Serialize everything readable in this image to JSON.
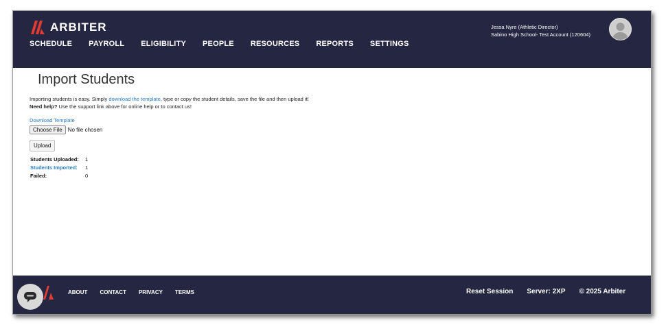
{
  "header": {
    "brand": "ARBITER",
    "nav": [
      "SCHEDULE",
      "PAYROLL",
      "ELIGIBILITY",
      "PEOPLE",
      "RESOURCES",
      "REPORTS",
      "SETTINGS"
    ],
    "user_name": "Jessa Nyre (Athletic Director)",
    "account": "Sabino High School- Test Account (120604)",
    "avatar_icon": "user-avatar-icon"
  },
  "main": {
    "title": "Import Students",
    "intro_prefix": "Importing students is easy. Simply ",
    "intro_link": "download the template",
    "intro_suffix": ", type or copy the student details, save the file and then upload it!",
    "help_label": "Need help?",
    "help_text": " Use the support link above for online help or to contact us!",
    "download_link": "Download Template",
    "choose_file": "Choose File",
    "no_file": "No file chosen",
    "upload": "Upload",
    "stats": [
      {
        "label": "Students Uploaded:",
        "value": "1"
      },
      {
        "label": "Students Imported:",
        "value": "1"
      },
      {
        "label": "Failed:",
        "value": "0"
      }
    ]
  },
  "footer": {
    "links": [
      "ABOUT",
      "CONTACT",
      "PRIVACY",
      "TERMS"
    ],
    "reset_session": "Reset Session",
    "server": "Server: 2XP",
    "copyright": "© 2025 Arbiter",
    "chat_icon": "chat-bubble-icon"
  },
  "colors": {
    "header_bg": "#252641",
    "brand_red": "#e03c31",
    "link_blue": "#2a7bc0"
  }
}
